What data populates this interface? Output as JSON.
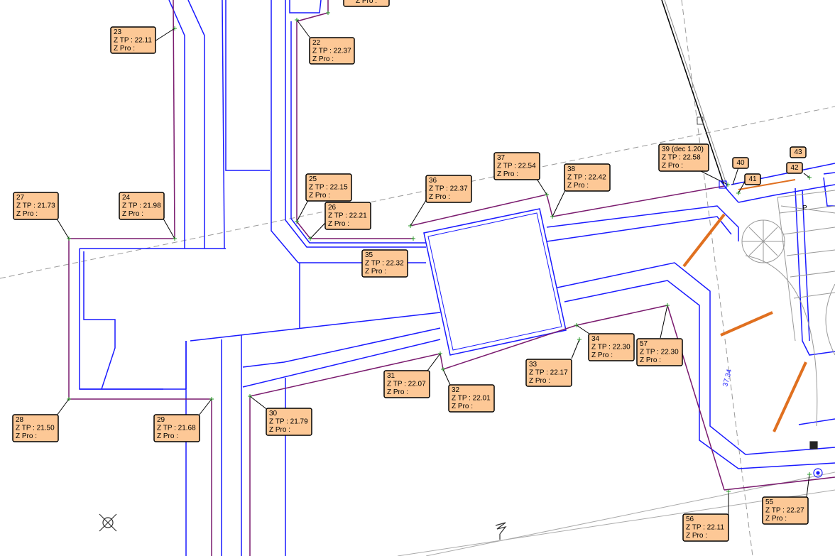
{
  "drawing": {
    "line_colors": {
      "wall": "#1a1aff",
      "path": "#7a1a6e",
      "gray": "#9a9a9a",
      "orange": "#e07020",
      "label_fill": "#fdc896",
      "label_stroke": "#000000"
    },
    "boxes": [
      {
        "id": "23",
        "lines": [
          "23",
          "Z TP : 22.11",
          "Z Pro :"
        ]
      },
      {
        "id": "22",
        "lines": [
          "22",
          "Z TP : 22.37",
          "Z Pro :"
        ]
      },
      {
        "id": "top",
        "lines": [
          "Z Pro :"
        ]
      },
      {
        "id": "27",
        "lines": [
          "27",
          "Z TP : 21.73",
          "Z Pro :"
        ]
      },
      {
        "id": "24",
        "lines": [
          "24",
          "Z TP : 21.98",
          "Z Pro :"
        ]
      },
      {
        "id": "25",
        "lines": [
          "25",
          "Z TP : 22.15",
          "Z Pro :"
        ]
      },
      {
        "id": "26",
        "lines": [
          "26",
          "Z TP : 22.21",
          "Z Pro :"
        ]
      },
      {
        "id": "35",
        "lines": [
          "35",
          "Z TP : 22.32",
          "Z Pro :"
        ]
      },
      {
        "id": "36",
        "lines": [
          "36",
          "Z TP : 22.37",
          "Z Pro :"
        ]
      },
      {
        "id": "37",
        "lines": [
          "37",
          "Z TP : 22.54",
          "Z Pro :"
        ]
      },
      {
        "id": "38",
        "lines": [
          "38",
          "Z TP : 22.42",
          "Z Pro :"
        ]
      },
      {
        "id": "39",
        "lines": [
          "39 (dec 1.20)",
          "Z TP : 22.58",
          "Z Pro :"
        ]
      },
      {
        "id": "28",
        "lines": [
          "28",
          "Z TP : 21.50",
          "Z Pro :"
        ]
      },
      {
        "id": "29",
        "lines": [
          "29",
          "Z TP : 21.68",
          "Z Pro :"
        ]
      },
      {
        "id": "30",
        "lines": [
          "30",
          "Z TP : 21.79",
          "Z Pro :"
        ]
      },
      {
        "id": "31",
        "lines": [
          "31",
          "Z TP : 22.07",
          "Z Pro :"
        ]
      },
      {
        "id": "32",
        "lines": [
          "32",
          "Z TP : 22.01",
          "Z Pro :"
        ]
      },
      {
        "id": "33",
        "lines": [
          "33",
          "Z TP : 22.17",
          "Z Pro :"
        ]
      },
      {
        "id": "34",
        "lines": [
          "34",
          "Z TP : 22.30",
          "Z Pro :"
        ]
      },
      {
        "id": "57",
        "lines": [
          "57",
          "Z TP : 22.30",
          "Z Pro :"
        ]
      },
      {
        "id": "55",
        "lines": [
          "55",
          "Z TP : 22.27",
          "Z Pro :"
        ]
      },
      {
        "id": "56",
        "lines": [
          "56",
          "Z TP : 22.11",
          "Z Pro :"
        ]
      },
      {
        "id": "40",
        "lines": [
          "40"
        ]
      },
      {
        "id": "41",
        "lines": [
          "41"
        ]
      },
      {
        "id": "42",
        "lines": [
          "42"
        ]
      },
      {
        "id": "43",
        "lines": [
          "43"
        ]
      }
    ],
    "dimension_text": "37.34",
    "parking_letter": "P"
  }
}
